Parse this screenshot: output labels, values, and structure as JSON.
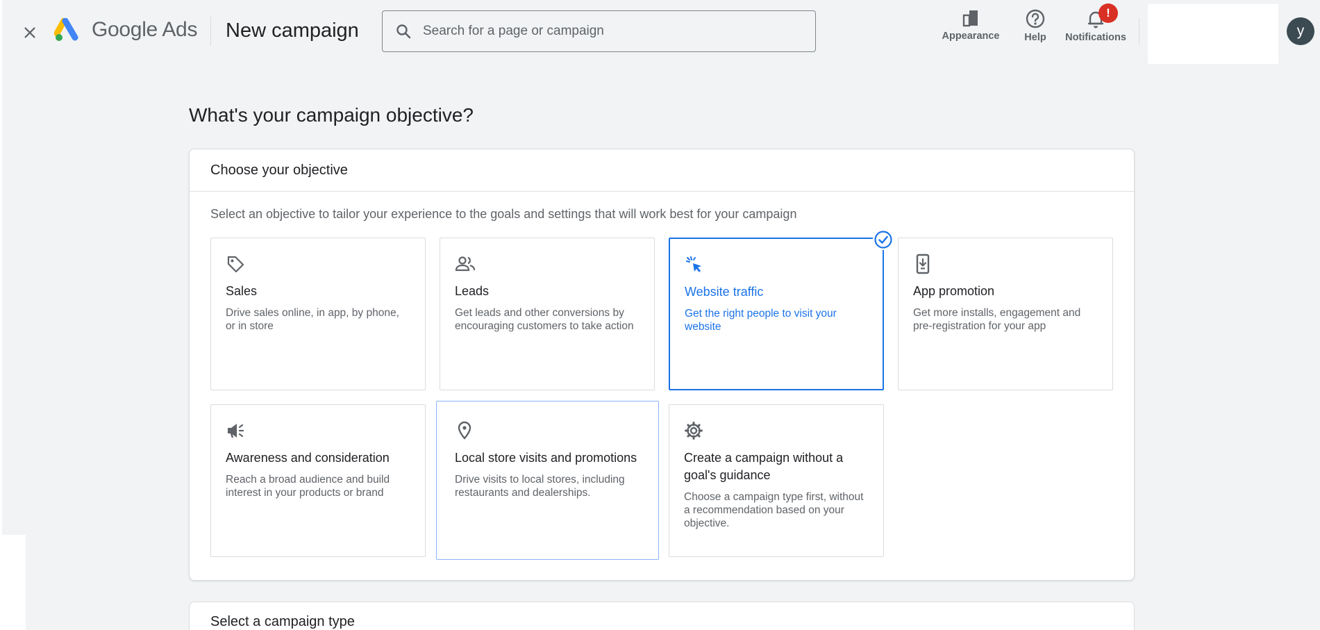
{
  "header": {
    "brand_google": "Google",
    "brand_ads": "Ads",
    "page_title": "New campaign",
    "search_placeholder": "Search for a page or campaign",
    "actions": {
      "appearance": "Appearance",
      "help": "Help",
      "notifications": "Notifications",
      "notification_badge": "!"
    },
    "avatar_initial": "y"
  },
  "main": {
    "question": "What's your campaign objective?",
    "objective_card": {
      "title": "Choose your objective",
      "description": "Select an objective to tailor your experience to the goals and settings that will work best for your campaign",
      "tiles": [
        {
          "icon": "tag-icon",
          "name": "Sales",
          "description": "Drive sales online, in app, by phone, or in store"
        },
        {
          "icon": "people-icon",
          "name": "Leads",
          "description": "Get leads and other conversions by encouraging customers to take action"
        },
        {
          "icon": "cursor-click-icon",
          "name": "Website traffic",
          "description": "Get the right people to visit your website",
          "selected": true
        },
        {
          "icon": "phone-download-icon",
          "name": "App promotion",
          "description": "Get more installs, engagement and pre-registration for your app"
        },
        {
          "icon": "megaphone-icon",
          "name": "Awareness and consideration",
          "description": "Reach a broad audience and build interest in your products or brand"
        },
        {
          "icon": "location-pin-icon",
          "name": "Local store visits and promotions",
          "description": "Drive visits to local stores, including restaurants and dealerships."
        },
        {
          "icon": "gear-icon",
          "name": "Create a campaign without a goal's guidance",
          "description": "Choose a campaign type first, without a recommendation based on your objective."
        }
      ]
    },
    "campaign_type_card": {
      "title": "Select a campaign type"
    }
  },
  "colors": {
    "accent": "#1a73e8",
    "background": "#f1f3f4",
    "badge_red": "#d93025"
  }
}
